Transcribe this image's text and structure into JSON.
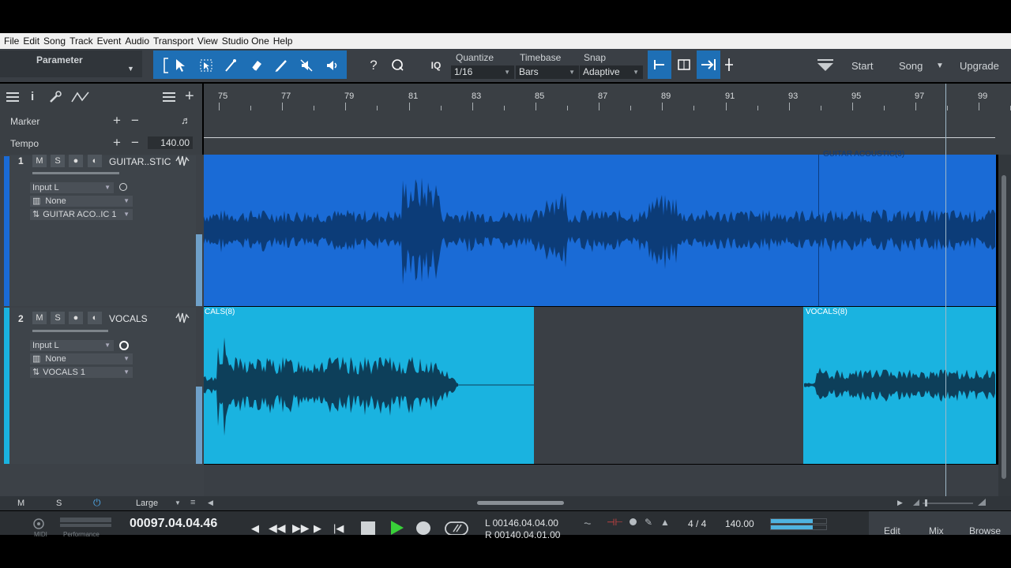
{
  "menu": [
    "File",
    "Edit",
    "Song",
    "Track",
    "Event",
    "Audio",
    "Transport",
    "View",
    "Studio One",
    "Help"
  ],
  "toolbar": {
    "parameter_label": "Parameter",
    "quantize_label": "Quantize",
    "quantize_value": "1/16",
    "timebase_label": "Timebase",
    "timebase_value": "Bars",
    "snap_label": "Snap",
    "snap_value": "Adaptive",
    "iq_label": "IQ",
    "start_label": "Start",
    "song_label": "Song",
    "upgrade_label": "Upgrade"
  },
  "ruler": {
    "bars": [
      "75",
      "77",
      "79",
      "81",
      "83",
      "85",
      "87",
      "89",
      "91",
      "93",
      "95",
      "97",
      "99"
    ]
  },
  "global_tracks": {
    "marker_label": "Marker",
    "tempo_label": "Tempo",
    "tempo_value": "140.00"
  },
  "tracks": [
    {
      "number": "1",
      "name": "GUITAR..STIC",
      "input": "Input L",
      "output": "None",
      "channel": "GUITAR ACO..IC 1",
      "color": "#1a6bd6"
    },
    {
      "number": "2",
      "name": "VOCALS",
      "input": "Input L",
      "output": "None",
      "channel": "VOCALS 1",
      "color": "#1ab3e0"
    }
  ],
  "clips": {
    "guitar_label": "GUITAR ACOUSTIC(3)",
    "vocals_a_label": "CALS(8)",
    "vocals_b_label": "VOCALS(8)"
  },
  "track_buttons": {
    "mute": "M",
    "solo": "S"
  },
  "bottom": {
    "m": "M",
    "s": "S",
    "size": "Large"
  },
  "transport": {
    "time": "00097.04.04.46",
    "loop_l": "L 00146.04.04.00",
    "loop_r": "R 00140.04.01.00",
    "signature": "4 / 4",
    "tempo": "140.00",
    "edit": "Edit",
    "mix": "Mix",
    "browse": "Browse",
    "performance": "Performance",
    "midi": "MIDI"
  }
}
